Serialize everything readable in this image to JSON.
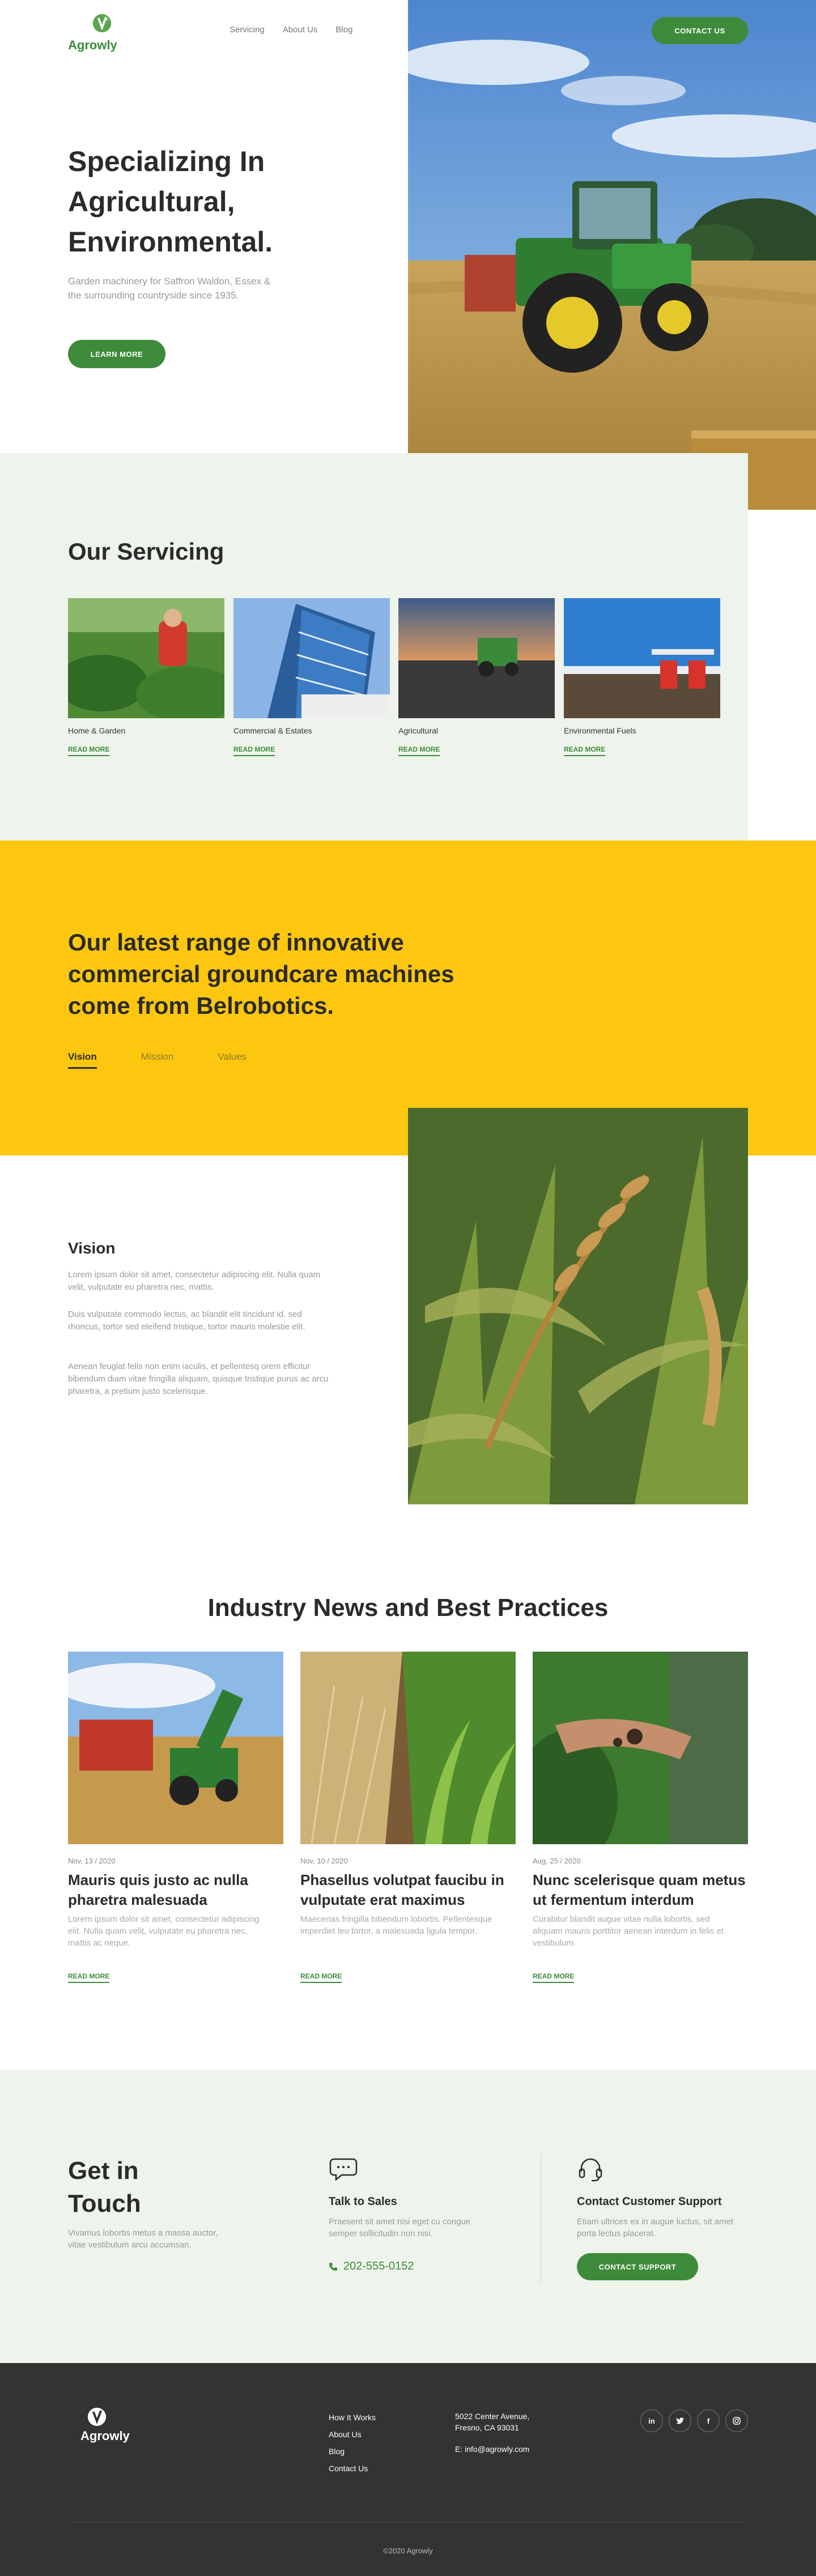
{
  "brand": {
    "name": "Agrowly"
  },
  "nav": {
    "items": [
      "Servicing",
      "About Us",
      "Blog"
    ],
    "cta": "CONTACT US"
  },
  "hero": {
    "title": "Specializing In Agricultural, Environmental.",
    "subtitle": "Garden machinery for Saffron Waldon, Essex & the surrounding countryside since 1935.",
    "button": "LEARN MORE"
  },
  "servicing": {
    "title": "Our Servicing",
    "cards": [
      {
        "name": "Home & Garden",
        "link": "READ MORE"
      },
      {
        "name": "Commercial & Estates",
        "link": "READ MORE"
      },
      {
        "name": "Agricultural",
        "link": "READ MORE"
      },
      {
        "name": "Environmental Fuels",
        "link": "READ MORE"
      }
    ]
  },
  "range": {
    "title": "Our latest range of innovative commercial groundcare machines come from Belrobotics.",
    "tabs": [
      "Vision",
      "Mission",
      "Values"
    ],
    "active_tab": "Vision"
  },
  "vision": {
    "title": "Vision",
    "paragraphs": [
      "Lorem ipsum dolor sit amet, consectetur adipiscing elit. Nulla quam velit, vulputate eu pharetra nec, mattis.",
      "Duis vulputate commodo lectus, ac blandit elit tincidunt id. sed rhoncus, tortor sed eleifend tristique, tortor mauris molestie elit.",
      "Aenean feugiat felis non enim iaculis, et pellentesq orem efficitur bibendum diam vitae fringilla aliquam, quisque tristique purus ac arcu pharetra, a pretium justo scelerisque."
    ]
  },
  "news": {
    "title": "Industry News and Best Practices",
    "items": [
      {
        "date": "Nov, 13 / 2020",
        "title": "Mauris quis justo ac nulla pharetra malesuada",
        "excerpt": "Lorem ipsum dolor sit amet, consectetur adipiscing elit. Nulla quam velit, vulputate eu pharetra nec, mattis ac neque.",
        "link": "READ MORE"
      },
      {
        "date": "Nov, 10 / 2020",
        "title": "Phasellus volutpat faucibu in vulputate erat maximus",
        "excerpt": "Maecenas fringilla bibendum lobortis. Pellentesque imperdiet leo tortor, a malesuada ligula tempor.",
        "link": "READ MORE"
      },
      {
        "date": "Aug, 25 / 2020",
        "title": "Nunc scelerisque quam metus ut fermentum interdum",
        "excerpt": "Curabitur blandit augue vitae nulla lobortis, sed aliquam mauris porttitor aenean interdum in felis et vestibulum.",
        "link": "READ MORE"
      }
    ]
  },
  "contact": {
    "title": "Get in Touch",
    "text": "Vivamus lobortis metus a massa auctor, vitae vestibulum arcu accumsan.",
    "sales": {
      "title": "Talk to Sales",
      "text": "Praesent sit amet nisi eget cu congue semper sollicitudin non nisi.",
      "phone": "202-555-0152",
      "icon": "chat-bubble-icon"
    },
    "support": {
      "title": "Contact Customer Support",
      "text": "Etiam ultrices ex in augue luctus, sit amet porta lectus placerat.",
      "button": "CONTACT SUPPORT",
      "icon": "headset-icon"
    }
  },
  "footer": {
    "links": [
      "How It Works",
      "About Us",
      "Blog",
      "Contact Us"
    ],
    "address": "5022 Center Avenue, Fresno, CA 93031",
    "email": "E: info@agrowly.com",
    "social": [
      "in",
      "t",
      "f",
      "ig"
    ],
    "copyright": "©2020 Agrowly"
  },
  "colors": {
    "green": "#3d8b3a",
    "yellow": "#fcc70e",
    "mint": "#eef4ec",
    "footer": "#333333"
  }
}
